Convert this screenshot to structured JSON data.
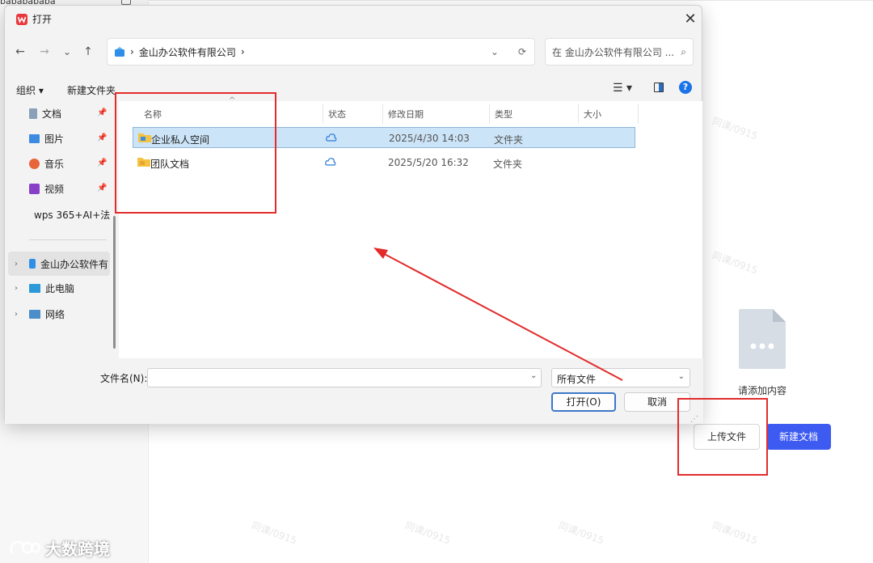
{
  "background_app": {
    "sidebar_title": "bababababa",
    "empty_state_text": "请添加内容",
    "upload_button": "上传文件",
    "new_doc_button": "新建文档",
    "brand_text": "大数跨境",
    "watermark": "同课/0915",
    "accent_color": "#3d5af1"
  },
  "dialog": {
    "title": "打开",
    "close_glyph": "✕",
    "nav": {
      "back": "←",
      "forward": "→",
      "recent": "⌄",
      "up": "↑"
    },
    "address": {
      "sep": "›",
      "location": "金山办公软件有限公司",
      "trail": "›"
    },
    "search_placeholder": "在 金山办公软件有限公司 ...",
    "toolbar": {
      "organize": "组织 ▾",
      "new_folder": "新建文件夹"
    },
    "nav_pane": [
      {
        "label": "文档",
        "icon": "document-icon"
      },
      {
        "label": "图片",
        "icon": "picture-icon"
      },
      {
        "label": "音乐",
        "icon": "music-icon"
      },
      {
        "label": "视频",
        "icon": "video-icon"
      },
      {
        "label": "wps 365+AI+法",
        "icon": "folder-icon"
      },
      {
        "label": "金山办公软件有",
        "icon": "cloud-drive-icon"
      },
      {
        "label": "此电脑",
        "icon": "computer-icon"
      },
      {
        "label": "网络",
        "icon": "network-icon"
      }
    ],
    "pin_glyph": "📌",
    "chevron_glyph": "›",
    "columns": {
      "name": "名称",
      "status": "状态",
      "modified": "修改日期",
      "type": "类型",
      "size": "大小",
      "sort_glyph": "^"
    },
    "files": [
      {
        "name": "企业私人空间",
        "modified": "2025/4/30 14:03",
        "type": "文件夹",
        "selected": true
      },
      {
        "name": "团队文档",
        "modified": "2025/5/20 16:32",
        "type": "文件夹",
        "selected": false
      }
    ],
    "file_name_label": "文件名(N):",
    "file_name_value": "",
    "file_type": "所有文件",
    "open_button": "打开(O)",
    "cancel_button": "取消",
    "dropdown_glyph": "⌄"
  },
  "annotations": {
    "color": "#e22b2b"
  }
}
